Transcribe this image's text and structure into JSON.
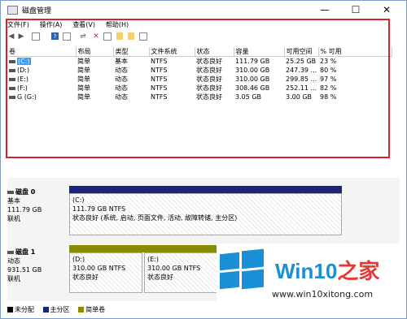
{
  "window": {
    "title": "磁盘管理"
  },
  "window_controls": {
    "minimize": "—",
    "maximize": "☐",
    "close": "✕"
  },
  "menu": [
    "文件(F)",
    "操作(A)",
    "查看(V)",
    "帮助(H)"
  ],
  "columns": [
    "卷",
    "布局",
    "类型",
    "文件系统",
    "状态",
    "容量",
    "可用空间",
    "% 可用"
  ],
  "volumes": [
    {
      "name": "(C:)",
      "layout": "简单",
      "type": "基本",
      "fs": "NTFS",
      "status": "状态良好",
      "capacity": "111.79 GB",
      "free": "25.25 GB",
      "pct": "23 %"
    },
    {
      "name": "(D:)",
      "layout": "简单",
      "type": "动态",
      "fs": "NTFS",
      "status": "状态良好",
      "capacity": "310.00 GB",
      "free": "247.39 ...",
      "pct": "80 %"
    },
    {
      "name": "(E:)",
      "layout": "简单",
      "type": "动态",
      "fs": "NTFS",
      "status": "状态良好",
      "capacity": "310.00 GB",
      "free": "299.85 ...",
      "pct": "97 %"
    },
    {
      "name": "(F:)",
      "layout": "简单",
      "type": "动态",
      "fs": "NTFS",
      "status": "状态良好",
      "capacity": "308.46 GB",
      "free": "252.11 ...",
      "pct": "82 %"
    },
    {
      "name": "G (G:)",
      "layout": "简单",
      "type": "动态",
      "fs": "NTFS",
      "status": "状态良好",
      "capacity": "3.05 GB",
      "free": "3.00 GB",
      "pct": "98 %"
    }
  ],
  "disk0": {
    "name": "磁盘 0",
    "type": "基本",
    "size": "111.79 GB",
    "state": "联机",
    "part": {
      "label": "(C:)",
      "size": "111.79 GB NTFS",
      "status": "状态良好 (系统, 启动, 页面文件, 活动, 故障转储, 主分区)"
    }
  },
  "disk1": {
    "name": "磁盘 1",
    "type": "动态",
    "size": "931.51 GB",
    "state": "联机",
    "parts": [
      {
        "label": "(D:)",
        "size": "310.00 GB NTFS",
        "status": "状态良好"
      },
      {
        "label": "(E:)",
        "size": "310.00 GB NTFS",
        "status": "状态良好"
      }
    ]
  },
  "legend": [
    "未分配",
    "主分区",
    "简单卷"
  ],
  "colors": {
    "unallocated": "#000000",
    "primary": "#1a237e",
    "simple": "#8b8b00",
    "highlight": "#d42430",
    "brand": "#1a8fd6"
  },
  "brand": {
    "title": "Win10",
    "title_zh": "之家",
    "url": "www.win10xitong.com"
  }
}
